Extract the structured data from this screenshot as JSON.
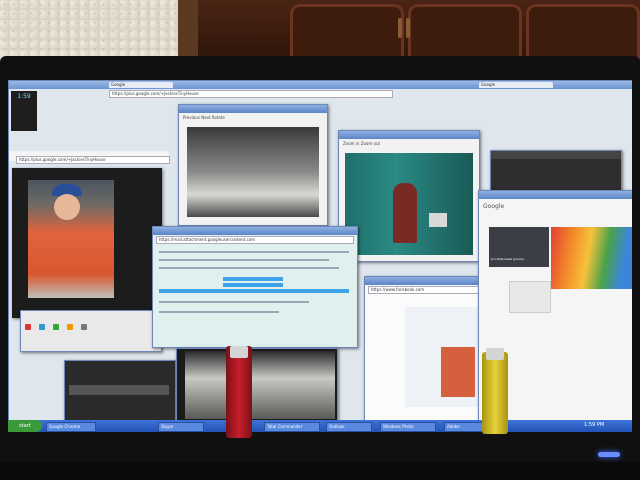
{
  "scene": {
    "description_colors": {
      "led": "#6a8cff",
      "taskbar": "#2452b5",
      "start": "#3a9a3a"
    }
  },
  "screen": {
    "clock": "1:59",
    "browser_url": "https://plus.google.com/+JackiesTinyHouse",
    "mail_url": "https://mail.attachment.googleusercontent.com",
    "photo_url": "https://www.facebook.com",
    "google_label": "Google",
    "profile_name": "Jon Dabrowski (Jonah)",
    "viewer_toolbar": [
      "Previous",
      "Next",
      "Rotate",
      "Zoom in",
      "Zoom out",
      "Print",
      "Delete"
    ],
    "taskbar": {
      "start": "start",
      "tasks": [
        "Google Chrome",
        "Skype",
        "Total Commander",
        "Outlook",
        "Windows Photo",
        "Adobe"
      ],
      "time": "1:59 PM"
    }
  }
}
